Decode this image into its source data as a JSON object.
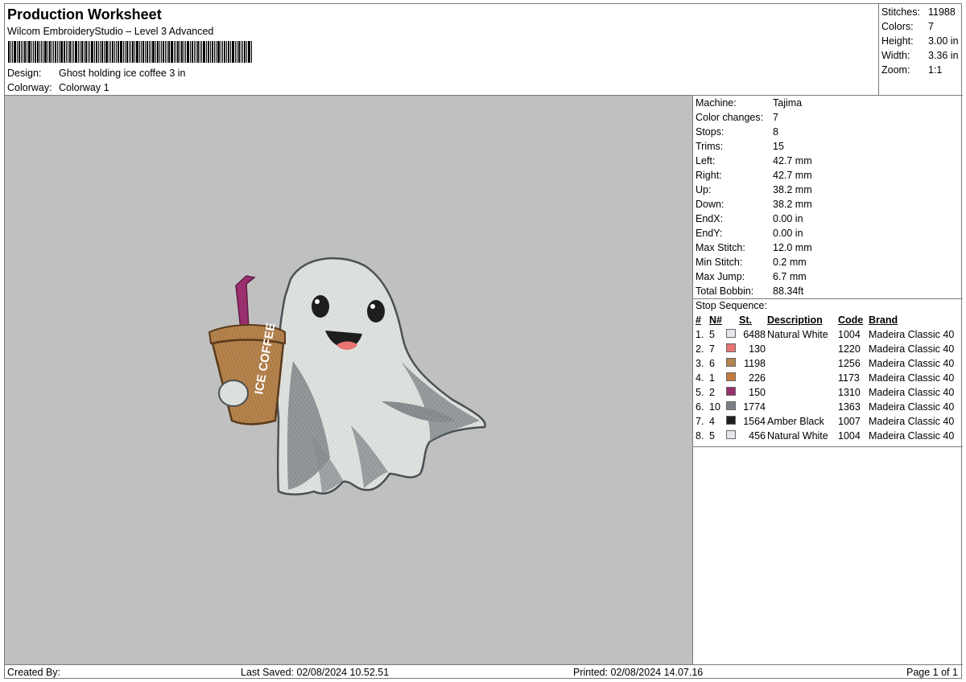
{
  "header": {
    "title": "Production Worksheet",
    "software": "Wilcom EmbroideryStudio – Level 3 Advanced",
    "design_label": "Design:",
    "design_value": "Ghost holding ice coffee 3 in",
    "colorway_label": "Colorway:",
    "colorway_value": "Colorway 1"
  },
  "summary": [
    {
      "label": "Stitches:",
      "value": "11988"
    },
    {
      "label": "Colors:",
      "value": "7"
    },
    {
      "label": "Height:",
      "value": "3.00 in"
    },
    {
      "label": "Width:",
      "value": "3.36 in"
    },
    {
      "label": "Zoom:",
      "value": "1:1"
    }
  ],
  "machine_info": [
    {
      "label": "Machine:",
      "value": "Tajima"
    },
    {
      "label": "Color changes:",
      "value": "7"
    },
    {
      "label": "Stops:",
      "value": "8"
    },
    {
      "label": "Trims:",
      "value": "15"
    },
    {
      "label": "Left:",
      "value": "42.7 mm"
    },
    {
      "label": "Right:",
      "value": "42.7 mm"
    },
    {
      "label": "Up:",
      "value": "38.2 mm"
    },
    {
      "label": "Down:",
      "value": "38.2 mm"
    },
    {
      "label": "EndX:",
      "value": "0.00 in"
    },
    {
      "label": "EndY:",
      "value": "0.00 in"
    },
    {
      "label": "Max Stitch:",
      "value": "12.0 mm"
    },
    {
      "label": "Min Stitch:",
      "value": "0.2 mm"
    },
    {
      "label": "Max Jump:",
      "value": "6.7 mm"
    },
    {
      "label": "Total Bobbin:",
      "value": "88.34ft"
    }
  ],
  "stop_sequence": {
    "title": "Stop Sequence:",
    "columns": {
      "num": "#",
      "n": "N#",
      "st": "St.",
      "desc": "Description",
      "code": "Code",
      "brand": "Brand"
    },
    "rows": [
      {
        "num": "1.",
        "n": "5",
        "color": "#e4e6ec",
        "st": "6488",
        "desc": "Natural White",
        "code": "1004",
        "brand": "Madeira Classic 40"
      },
      {
        "num": "2.",
        "n": "7",
        "color": "#e97472",
        "st": "130",
        "desc": "",
        "code": "1220",
        "brand": "Madeira Classic 40"
      },
      {
        "num": "3.",
        "n": "6",
        "color": "#b5834d",
        "st": "1198",
        "desc": "",
        "code": "1256",
        "brand": "Madeira Classic 40"
      },
      {
        "num": "4.",
        "n": "1",
        "color": "#c67a3c",
        "st": "226",
        "desc": "",
        "code": "1173",
        "brand": "Madeira Classic 40"
      },
      {
        "num": "5.",
        "n": "2",
        "color": "#9a2f6e",
        "st": "150",
        "desc": "",
        "code": "1310",
        "brand": "Madeira Classic 40"
      },
      {
        "num": "6.",
        "n": "10",
        "color": "#7d8187",
        "st": "1774",
        "desc": "",
        "code": "1363",
        "brand": "Madeira Classic 40"
      },
      {
        "num": "7.",
        "n": "4",
        "color": "#1e1e1e",
        "st": "1564",
        "desc": "Amber Black",
        "code": "1007",
        "brand": "Madeira Classic 40"
      },
      {
        "num": "8.",
        "n": "5",
        "color": "#e4e6ec",
        "st": "456",
        "desc": "Natural White",
        "code": "1004",
        "brand": "Madeira Classic 40"
      }
    ]
  },
  "cup_text": "ICE COFFEE",
  "footer": {
    "created_by": "Created By:",
    "last_saved": "Last Saved: 02/08/2024 10.52.51",
    "printed": "Printed: 02/08/2024 14.07.16",
    "page": "Page 1 of 1"
  }
}
